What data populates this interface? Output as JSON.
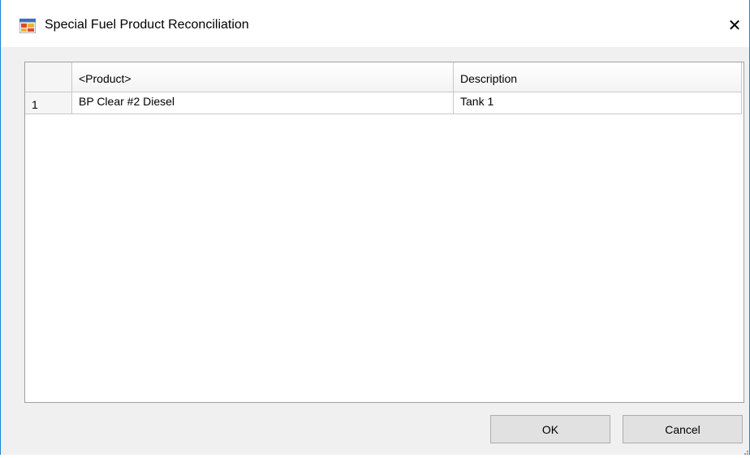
{
  "window": {
    "title": "Special Fuel Product Reconciliation",
    "app_icon": "app-window-icon",
    "close_icon": "close-icon",
    "close_glyph": "✕"
  },
  "grid": {
    "columns": [
      "",
      "<Product>",
      "Description"
    ],
    "rows": [
      {
        "row_number": "1",
        "product": "BP Clear #2 Diesel",
        "description": "Tank 1"
      }
    ]
  },
  "buttons": {
    "ok_label": "OK",
    "cancel_label": "Cancel"
  },
  "colors": {
    "window_border": "#1883d7",
    "dialog_background": "#f0f0f0",
    "button_background": "#e1e1e1"
  }
}
